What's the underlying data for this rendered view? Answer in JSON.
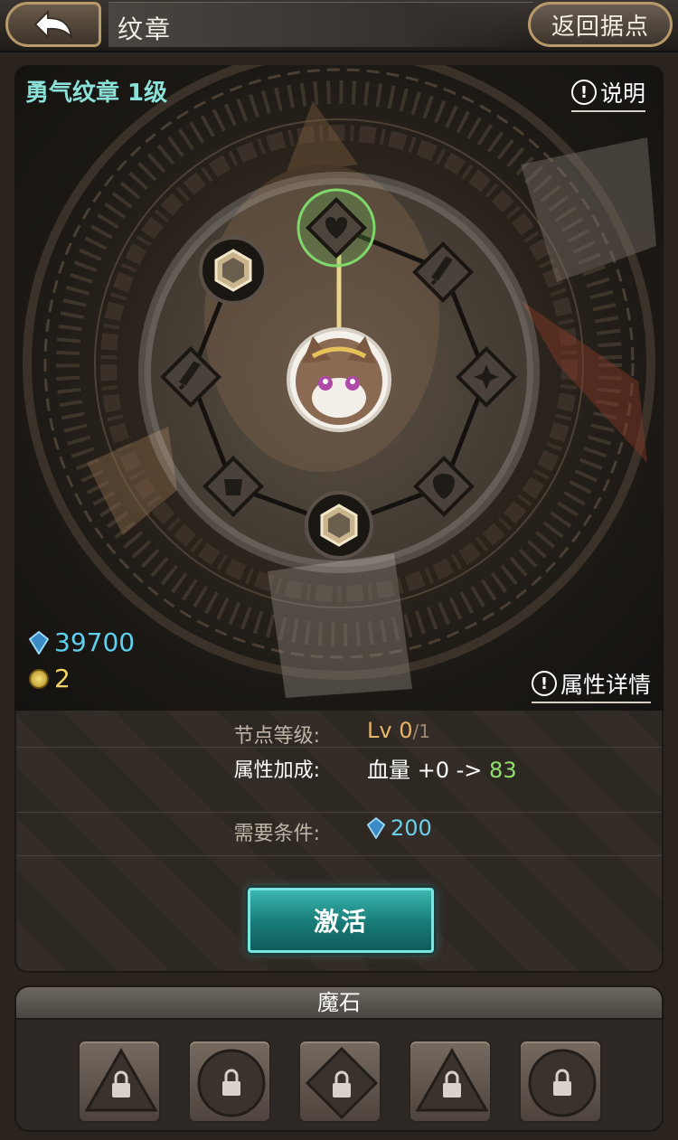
{
  "header": {
    "back_label": "",
    "title": "纹章",
    "home_label": "返回据点"
  },
  "emblem": {
    "name": "勇气纹章 1级",
    "help_label": "说明",
    "attr_detail_label": "属性详情",
    "crystal_amount": "39700",
    "coin_amount": "2",
    "nodes": [
      {
        "shape": "diamond",
        "icon": "heart-icon",
        "state": "selected"
      },
      {
        "shape": "diamond",
        "icon": "sword-icon",
        "state": "locked"
      },
      {
        "shape": "diamond",
        "icon": "sparkle-icon",
        "state": "locked"
      },
      {
        "shape": "diamond",
        "icon": "shield-icon",
        "state": "locked"
      },
      {
        "shape": "circle",
        "icon": "hexagon-gem-icon",
        "state": "milestone"
      },
      {
        "shape": "diamond",
        "icon": "armor-icon",
        "state": "locked"
      },
      {
        "shape": "diamond",
        "icon": "sword-icon",
        "state": "locked"
      },
      {
        "shape": "circle",
        "icon": "hexagon-gem-icon",
        "state": "milestone"
      }
    ]
  },
  "details": {
    "level_label": "节点等级:",
    "level_value": "Lv 0",
    "level_max": "/1",
    "bonus_label": "属性加成:",
    "bonus_value": "血量 +0 ->",
    "bonus_to": "83",
    "cost_label": "需要条件:",
    "cost_value": "200",
    "activate_label": "激活"
  },
  "magic_stone": {
    "title": "魔石",
    "slots": [
      {
        "shape": "triangle",
        "state": "locked"
      },
      {
        "shape": "circle",
        "state": "locked"
      },
      {
        "shape": "diamond",
        "state": "locked"
      },
      {
        "shape": "triangle",
        "state": "locked"
      },
      {
        "shape": "circle",
        "state": "locked"
      }
    ]
  },
  "colors": {
    "accent_teal": "#39b6af",
    "crystal_blue": "#5fd0ee",
    "level_orange": "#e8b46a",
    "bonus_green": "#8fe06a",
    "selected_glow": "#7fd86a"
  }
}
